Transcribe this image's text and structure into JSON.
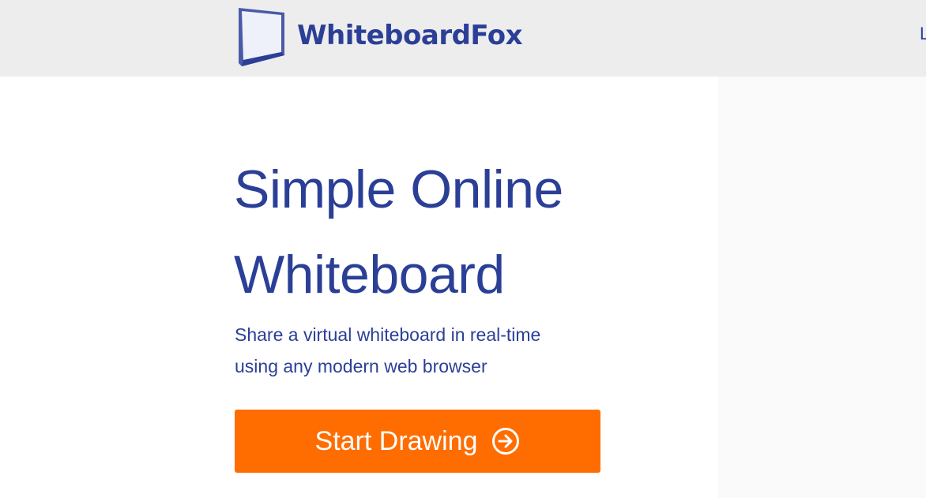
{
  "header": {
    "brand_name": "WhiteboardFox",
    "right_link_partial": "L"
  },
  "hero": {
    "title_line1": "Simple Online",
    "title_line2": "Whiteboard",
    "subtitle_line1": "Share a virtual whiteboard in real-time",
    "subtitle_line2": "using any modern web browser",
    "cta_label": "Start Drawing",
    "cta_icon": "arrow-right-circle-icon"
  },
  "colors": {
    "brand_blue": "#2b3f97",
    "cta_orange": "#ff6d00",
    "header_bg": "#ededed",
    "side_panel_bg": "#fafafa"
  }
}
